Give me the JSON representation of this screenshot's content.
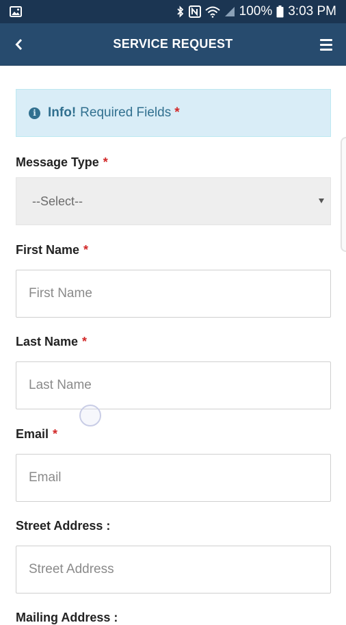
{
  "status_bar": {
    "battery": "100%",
    "time": "3:03 PM"
  },
  "header": {
    "title": "SERVICE REQUEST"
  },
  "info": {
    "strong": "Info!",
    "text": "Required Fields",
    "required_marker": "*"
  },
  "form": {
    "message_type": {
      "label": "Message Type",
      "required": "*",
      "selected": "--Select--"
    },
    "first_name": {
      "label": "First Name",
      "required": "*",
      "placeholder": "First Name"
    },
    "last_name": {
      "label": "Last Name",
      "required": "*",
      "placeholder": "Last Name"
    },
    "email": {
      "label": "Email",
      "required": "*",
      "placeholder": "Email"
    },
    "street_address": {
      "label": "Street Address :",
      "placeholder": "Street Address"
    },
    "mailing_address": {
      "label": "Mailing Address :"
    }
  },
  "colors": {
    "status_bar": "#1b3552",
    "app_bar": "#274b6e",
    "info_bg": "#d9edf7",
    "info_text": "#31708f",
    "required": "#d22828"
  },
  "icons": {
    "status_left": "image-icon",
    "status_right": [
      "bluetooth-icon",
      "nfc-icon",
      "wifi-icon",
      "signal-icon",
      "battery-icon"
    ],
    "back": "chevron-left-icon",
    "menu": "hamburger-menu-icon",
    "info": "info-circle-icon",
    "caret": "caret-down-icon"
  }
}
